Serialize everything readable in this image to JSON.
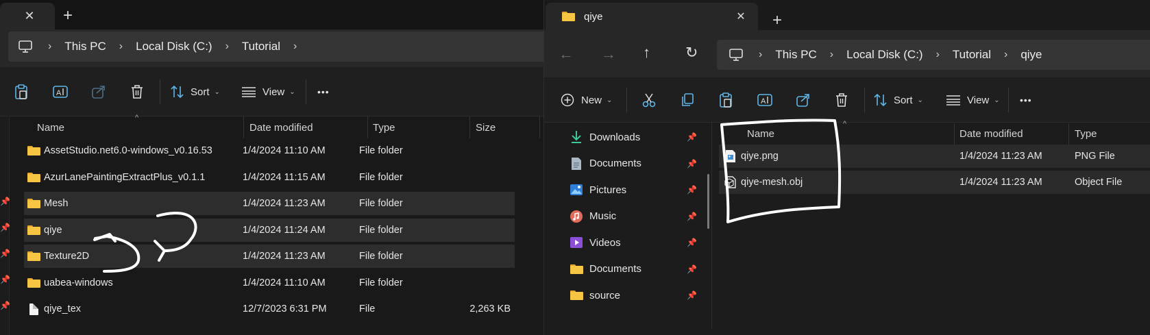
{
  "left": {
    "tab_close": "✕",
    "tab_new": "+",
    "breadcrumbs": [
      "This PC",
      "Local Disk (C:)",
      "Tutorial"
    ],
    "toolbar": {
      "sort": "Sort",
      "view": "View",
      "more": "•••"
    },
    "columns": [
      "Name",
      "Date modified",
      "Type",
      "Size"
    ],
    "files": [
      {
        "name": "AssetStudio.net6.0-windows_v0.16.53",
        "date": "1/4/2024 11:10 AM",
        "type": "File folder",
        "size": "",
        "icon": "folder-icon"
      },
      {
        "name": "AzurLanePaintingExtractPlus_v0.1.1",
        "date": "1/4/2024 11:15 AM",
        "type": "File folder",
        "size": "",
        "icon": "folder-icon"
      },
      {
        "name": "Mesh",
        "date": "1/4/2024 11:23 AM",
        "type": "File folder",
        "size": "",
        "icon": "folder-icon"
      },
      {
        "name": "qiye",
        "date": "1/4/2024 11:24 AM",
        "type": "File folder",
        "size": "",
        "icon": "folder-icon"
      },
      {
        "name": "Texture2D",
        "date": "1/4/2024 11:23 AM",
        "type": "File folder",
        "size": "",
        "icon": "folder-icon"
      },
      {
        "name": "uabea-windows",
        "date": "1/4/2024 11:10 AM",
        "type": "File folder",
        "size": "",
        "icon": "folder-icon"
      },
      {
        "name": "qiye_tex",
        "date": "12/7/2023 6:31 PM",
        "type": "File",
        "size": "2,263 KB",
        "icon": "file-icon"
      }
    ]
  },
  "right": {
    "tab_title": "qiye",
    "tab_close": "✕",
    "tab_new": "+",
    "breadcrumbs": [
      "This PC",
      "Local Disk (C:)",
      "Tutorial",
      "qiye"
    ],
    "toolbar": {
      "new": "New",
      "sort": "Sort",
      "view": "View",
      "more": "•••"
    },
    "nav": [
      {
        "label": "Downloads",
        "icon": "downloads-icon"
      },
      {
        "label": "Documents",
        "icon": "documents-icon"
      },
      {
        "label": "Pictures",
        "icon": "pictures-icon"
      },
      {
        "label": "Music",
        "icon": "music-icon"
      },
      {
        "label": "Videos",
        "icon": "videos-icon"
      },
      {
        "label": "Documents",
        "icon": "folder-icon"
      },
      {
        "label": "source",
        "icon": "folder-icon"
      }
    ],
    "columns": [
      "Name",
      "Date modified",
      "Type"
    ],
    "files": [
      {
        "name": "qiye.png",
        "date": "1/4/2024 11:23 AM",
        "type": "PNG File",
        "icon": "png-file-icon"
      },
      {
        "name": "qiye-mesh.obj",
        "date": "1/4/2024 11:23 AM",
        "type": "Object File",
        "icon": "obj-file-icon"
      }
    ]
  },
  "colors": {
    "folder": "#f7c544",
    "accent": "#4cc2ff",
    "annotation": "#ffffff"
  }
}
